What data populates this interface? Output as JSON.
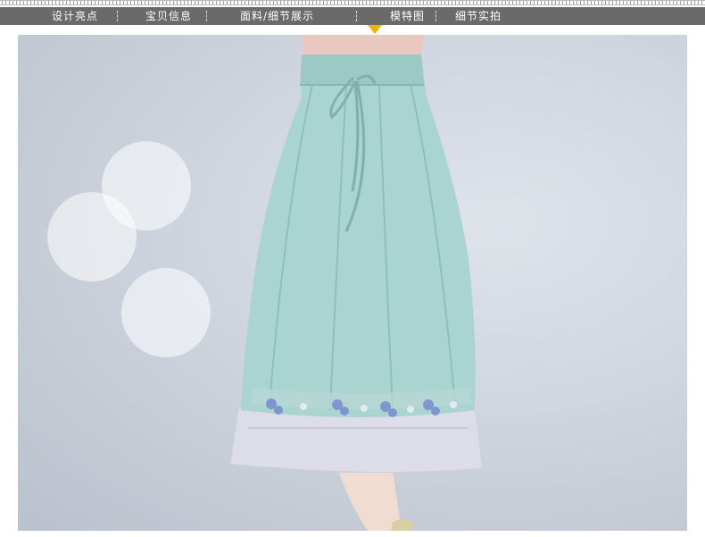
{
  "nav": {
    "tabs": [
      {
        "label": "设计亮点"
      },
      {
        "label": "宝贝信息"
      },
      {
        "label": "面料/细节展示"
      },
      {
        "label": "模特图"
      },
      {
        "label": "细节实拍"
      }
    ],
    "active_index": 3,
    "colors": {
      "bar": "#6a6a6a",
      "marker": "#f0b400",
      "text": "#ffffff"
    }
  },
  "photo": {
    "subject": "skirt-photo",
    "colors": {
      "background": "#cfd5de",
      "skirt": "#a9d4cf",
      "lining": "#dcdde8",
      "embroidery": "#7a8fd0"
    }
  }
}
